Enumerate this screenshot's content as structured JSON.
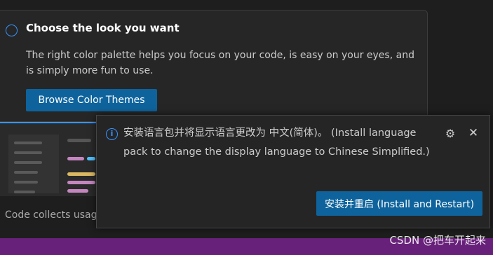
{
  "walkthrough": {
    "title": "Choose the look you want",
    "description": "The right color palette helps you focus on your code, is easy on your eyes, and is simply more fun to use.",
    "browse_button": "Browse Color Themes",
    "collects_text": "Code collects usag"
  },
  "notification": {
    "message": "安装语言包并将显示语言更改为 中文(简体)。 (Install language pack to change the display language to Chinese Simplified.)",
    "install_button": "安装并重启 (Install and Restart)",
    "info_glyph": "i",
    "gear_glyph": "⚙",
    "close_glyph": "✕"
  },
  "watermark": "CSDN @把车开起来",
  "colors": {
    "accent": "#3794ff",
    "button": "#0e639c",
    "statusbar": "#68217a"
  }
}
